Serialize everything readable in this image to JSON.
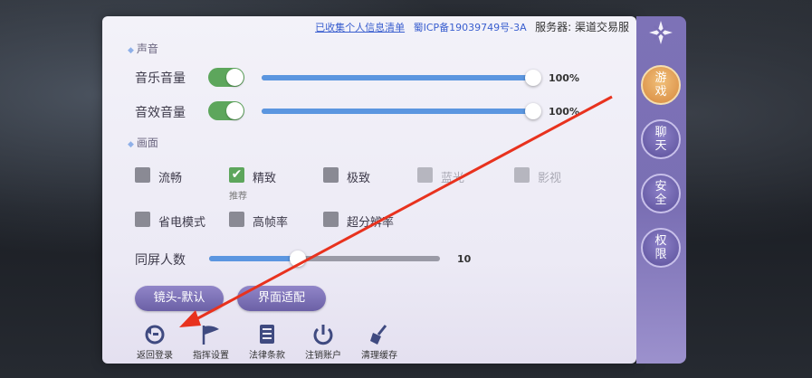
{
  "header": {
    "privacy_link": "已收集个人信息清单",
    "icp": "蜀ICP备19039749号-3A",
    "server": "服务器: 渠道交易服"
  },
  "sound": {
    "section_title": "声音",
    "music_label": "音乐音量",
    "music_value": "100%",
    "music_level": 100,
    "effect_label": "音效音量",
    "effect_value": "100%",
    "effect_level": 100
  },
  "graphics": {
    "section_title": "画面",
    "options": [
      {
        "label": "流畅",
        "checked": false,
        "disabled": false
      },
      {
        "label": "精致",
        "checked": true,
        "disabled": false
      },
      {
        "label": "极致",
        "checked": false,
        "disabled": false
      },
      {
        "label": "蓝光",
        "checked": false,
        "disabled": true
      },
      {
        "label": "影视",
        "checked": false,
        "disabled": true
      }
    ],
    "recommend_note": "推荐",
    "extra": [
      {
        "label": "省电模式",
        "checked": false
      },
      {
        "label": "高帧率",
        "checked": false
      },
      {
        "label": "超分辨率",
        "checked": false
      }
    ],
    "players_label": "同屏人数",
    "players_value": "10"
  },
  "buttons": {
    "camera": "镜头-默认",
    "ui_adapt": "界面适配"
  },
  "bottom": {
    "items": [
      {
        "label": "返回登录",
        "icon": "return-icon"
      },
      {
        "label": "指挥设置",
        "icon": "flag-icon"
      },
      {
        "label": "法律条款",
        "icon": "document-icon"
      },
      {
        "label": "注销账户",
        "icon": "power-icon"
      },
      {
        "label": "清理缓存",
        "icon": "broom-icon"
      }
    ]
  },
  "side_tabs": [
    {
      "label": "游戏",
      "active": true
    },
    {
      "label": "聊天",
      "active": false
    },
    {
      "label": "安全",
      "active": false
    },
    {
      "label": "权限",
      "active": false
    }
  ],
  "colors": {
    "accent_green": "#5da65c",
    "slider_blue": "#5b96e0",
    "button_purple": "#7a6fb4",
    "annotation_red": "#e8321e"
  }
}
